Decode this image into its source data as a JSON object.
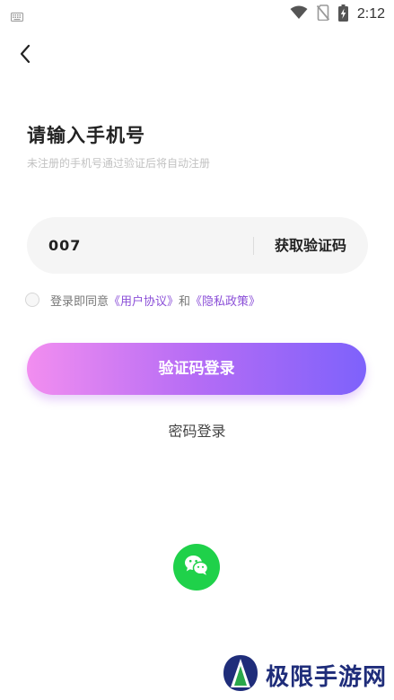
{
  "status_bar": {
    "time": "2:12"
  },
  "icons": {
    "keyboard": "keyboard-icon",
    "wifi": "wifi-icon",
    "no_sim": "no-sim-icon",
    "battery": "battery-charging-icon",
    "back": "back-arrow-icon",
    "wechat": "wechat-icon"
  },
  "header": {
    "title": "请输入手机号",
    "subtitle": "未注册的手机号通过验证后将自动注册"
  },
  "phone": {
    "value": "007",
    "get_code_label": "获取验证码"
  },
  "agreement": {
    "prefix": "登录即同意",
    "user_agreement": "《用户协议》",
    "conjunction": "和",
    "privacy_policy": "《隐私政策》",
    "link_color": "#8b4fd8"
  },
  "login_button": {
    "label": "验证码登录",
    "gradient": [
      "#f28ef0",
      "#b56cf5",
      "#7e62fb"
    ]
  },
  "password_login": {
    "label": "密码登录"
  },
  "wechat_color": "#1fd14a",
  "watermark": {
    "text": "极限手游网"
  }
}
